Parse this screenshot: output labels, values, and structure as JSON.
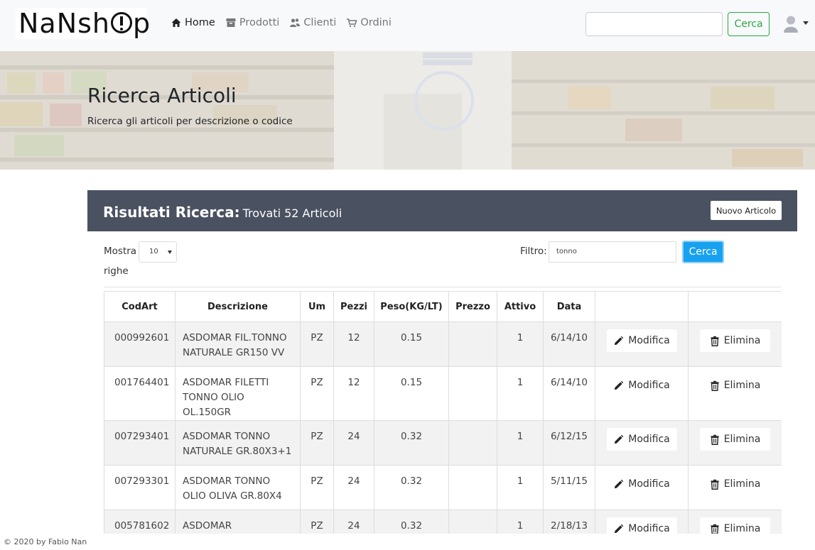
{
  "brand": {
    "logo_text_a": "NaNsh",
    "logo_text_b": "p"
  },
  "nav": {
    "items": [
      {
        "label": "Home",
        "icon": "home-icon",
        "active": true
      },
      {
        "label": "Prodotti",
        "icon": "archive-icon",
        "active": false
      },
      {
        "label": "Clienti",
        "icon": "users-icon",
        "active": false
      },
      {
        "label": "Ordini",
        "icon": "cart-icon",
        "active": false
      }
    ],
    "search_value": "",
    "search_button": "Cerca",
    "user_icon": "user-avatar-icon"
  },
  "hero": {
    "title": "Ricerca Articoli",
    "subtitle": "Ricerca gli articoli per descrizione o codice"
  },
  "results": {
    "title": "Risultati Ricerca:",
    "count_text": "Trovati 52 Articoli",
    "new_button": "Nuovo Articolo"
  },
  "controls": {
    "mostra_label": "Mostra",
    "righe_label": "righe",
    "page_size": "10",
    "filtro_label": "Filtro:",
    "filtro_value": "tonno",
    "filtro_button": "Cerca"
  },
  "table": {
    "headers": [
      "CodArt",
      "Descrizione",
      "Um",
      "Pezzi",
      "Peso(KG/LT)",
      "Prezzo",
      "Attivo",
      "Data",
      "",
      ""
    ],
    "edit_label": "Modifica",
    "delete_label": "Elimina",
    "rows": [
      {
        "codart": "000992601",
        "descr": "ASDOMAR FIL.TONNO NATURALE GR150 VV",
        "um": "PZ",
        "pezzi": "12",
        "peso": "0.15",
        "prezzo": "",
        "attivo": "1",
        "data": "6/14/10"
      },
      {
        "codart": "001764401",
        "descr": "ASDOMAR FILETTI TONNO OLIO OL.150GR",
        "um": "PZ",
        "pezzi": "12",
        "peso": "0.15",
        "prezzo": "",
        "attivo": "1",
        "data": "6/14/10"
      },
      {
        "codart": "007293401",
        "descr": "ASDOMAR TONNO NATURALE GR.80X3+1",
        "um": "PZ",
        "pezzi": "24",
        "peso": "0.32",
        "prezzo": "",
        "attivo": "1",
        "data": "6/12/15"
      },
      {
        "codart": "007293301",
        "descr": "ASDOMAR TONNO OLIO OLIVA GR.80X4",
        "um": "PZ",
        "pezzi": "24",
        "peso": "0.32",
        "prezzo": "",
        "attivo": "1",
        "data": "5/11/15"
      },
      {
        "codart": "005781602",
        "descr": "ASDOMAR TONNO/FAGIOLI GR",
        "um": "PZ",
        "pezzi": "24",
        "peso": "0.32",
        "prezzo": "",
        "attivo": "1",
        "data": "2/18/13"
      }
    ]
  },
  "footer": {
    "text": "© 2020 by Fabio Nan"
  },
  "colors": {
    "results_bar": "#4a5161",
    "search_green": "#28a745",
    "filter_blue": "#17a2f0",
    "row_stripe": "#f2f2f2"
  }
}
